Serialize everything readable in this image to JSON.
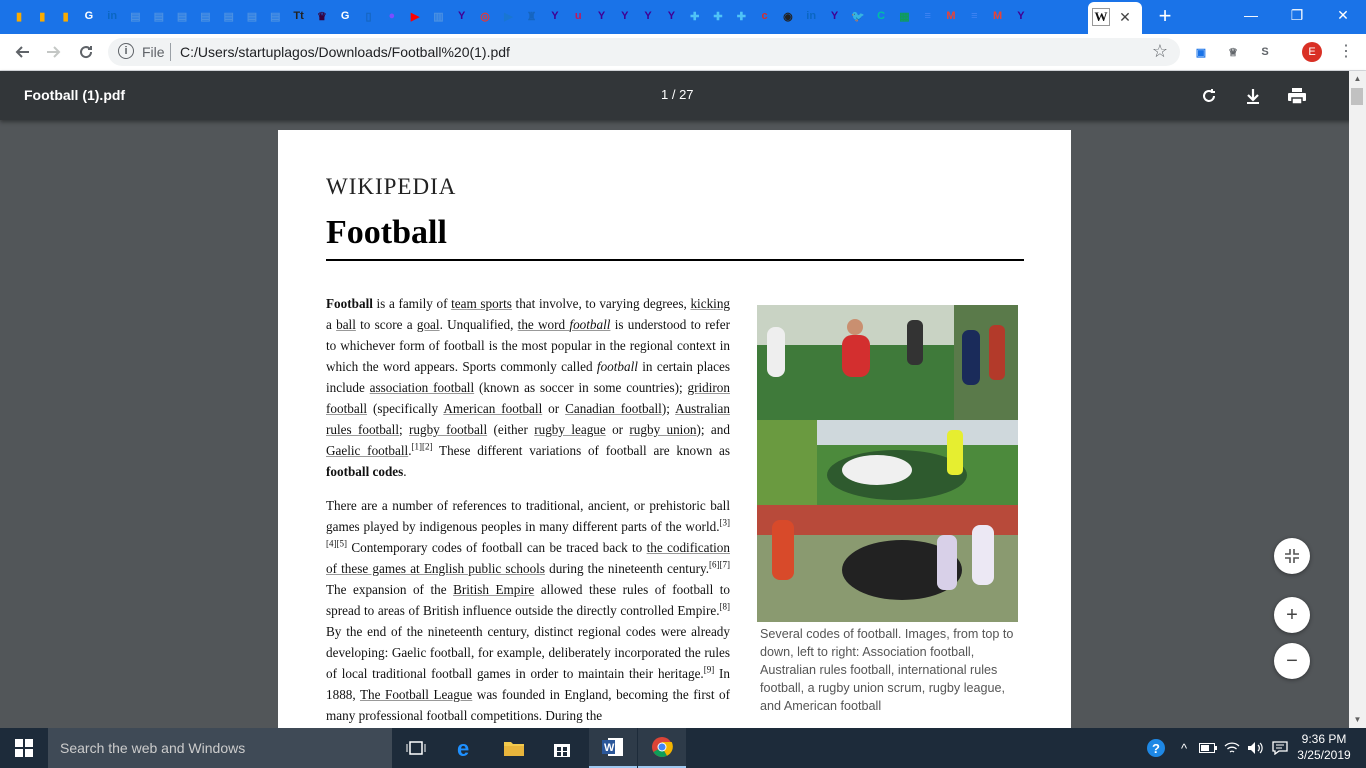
{
  "browser": {
    "tabs": [
      {
        "icon": "analytics-icon",
        "glyph": "▮",
        "color": "#f9ab00"
      },
      {
        "icon": "analytics-icon",
        "glyph": "▮",
        "color": "#f9ab00"
      },
      {
        "icon": "analytics-icon",
        "glyph": "▮",
        "color": "#f9ab00"
      },
      {
        "icon": "google-icon",
        "glyph": "G",
        "color": "#ffffff"
      },
      {
        "icon": "linkedin-icon",
        "glyph": "in",
        "color": "#0a66c2"
      },
      {
        "icon": "site-icon",
        "glyph": "▤",
        "color": "#4a90e2"
      },
      {
        "icon": "site-icon",
        "glyph": "▤",
        "color": "#4a90e2"
      },
      {
        "icon": "site-icon",
        "glyph": "▤",
        "color": "#4a90e2"
      },
      {
        "icon": "site-icon",
        "glyph": "▤",
        "color": "#4a90e2"
      },
      {
        "icon": "site-icon",
        "glyph": "▤",
        "color": "#4a90e2"
      },
      {
        "icon": "site-icon",
        "glyph": "▤",
        "color": "#4a90e2"
      },
      {
        "icon": "site-icon",
        "glyph": "▤",
        "color": "#4a90e2"
      },
      {
        "icon": "tt-icon",
        "glyph": "Tt",
        "color": "#222222"
      },
      {
        "icon": "premier-league-icon",
        "glyph": "♛",
        "color": "#37003c"
      },
      {
        "icon": "google-icon",
        "glyph": "G",
        "color": "#ffffff"
      },
      {
        "icon": "doc-icon",
        "glyph": "▯",
        "color": "#1565c0"
      },
      {
        "icon": "circle-icon",
        "glyph": "●",
        "color": "#7c4dff"
      },
      {
        "icon": "youtube-icon",
        "glyph": "▶",
        "color": "#ff0000"
      },
      {
        "icon": "chart-icon",
        "glyph": "▥",
        "color": "#4a90e2"
      },
      {
        "icon": "yahoo-icon",
        "glyph": "Y",
        "color": "#410093"
      },
      {
        "icon": "site-icon",
        "glyph": "◎",
        "color": "#e53935"
      },
      {
        "icon": "play-icon",
        "glyph": "▶",
        "color": "#1976d2"
      },
      {
        "icon": "crest-icon",
        "glyph": "♜",
        "color": "#1565c0"
      },
      {
        "icon": "yahoo-icon",
        "glyph": "Y",
        "color": "#410093"
      },
      {
        "icon": "site-icon",
        "glyph": "u",
        "color": "#c2185b"
      },
      {
        "icon": "yahoo-icon",
        "glyph": "Y",
        "color": "#410093"
      },
      {
        "icon": "yahoo-icon",
        "glyph": "Y",
        "color": "#410093"
      },
      {
        "icon": "yahoo-icon",
        "glyph": "Y",
        "color": "#410093"
      },
      {
        "icon": "yahoo-icon",
        "glyph": "Y",
        "color": "#410093"
      },
      {
        "icon": "plus-app-icon",
        "glyph": "✚",
        "color": "#4fc3f7"
      },
      {
        "icon": "plus-app-icon",
        "glyph": "✚",
        "color": "#4fc3f7"
      },
      {
        "icon": "plus-app-icon",
        "glyph": "✚",
        "color": "#4fc3f7"
      },
      {
        "icon": "site-icon",
        "glyph": "c",
        "color": "#d32f2f"
      },
      {
        "icon": "chat-icon",
        "glyph": "◉",
        "color": "#212121"
      },
      {
        "icon": "linkedin-icon",
        "glyph": "in",
        "color": "#0a66c2"
      },
      {
        "icon": "yahoo-icon",
        "glyph": "Y",
        "color": "#410093"
      },
      {
        "icon": "twitter-icon",
        "glyph": "🐦",
        "color": "#1da1f2"
      },
      {
        "icon": "site-icon",
        "glyph": "C",
        "color": "#00bfa5"
      },
      {
        "icon": "sheets-icon",
        "glyph": "▦",
        "color": "#0f9d58"
      },
      {
        "icon": "docs-icon",
        "glyph": "≡",
        "color": "#4285f4"
      },
      {
        "icon": "gmail-icon",
        "glyph": "M",
        "color": "#ea4335"
      },
      {
        "icon": "docs-icon",
        "glyph": "≡",
        "color": "#4285f4"
      },
      {
        "icon": "gmail-icon",
        "glyph": "M",
        "color": "#ea4335"
      },
      {
        "icon": "yahoo-icon",
        "glyph": "Y",
        "color": "#410093"
      }
    ],
    "active_tab": {
      "icon": "wikipedia-icon",
      "glyph": "W",
      "close": "✕"
    },
    "new_tab": "+",
    "window_controls": {
      "minimize": "—",
      "restore": "❐",
      "close": "✕"
    },
    "address": {
      "security_label": "File",
      "url": "C:/Users/startuplagos/Downloads/Football%20(1).pdf"
    },
    "extensions": [
      {
        "icon": "bookmark-app-icon",
        "glyph": "▣",
        "color": "#1a73e8"
      },
      {
        "icon": "trophy-icon",
        "glyph": "♕",
        "color": "#5f6368"
      },
      {
        "icon": "s-extension-icon",
        "glyph": "S",
        "color": "#5f6368"
      }
    ],
    "profile_initial": "E"
  },
  "pdf": {
    "title": "Football (1).pdf",
    "page_indicator": "1 / 27"
  },
  "document": {
    "wordmark": "WIKIPEDIA",
    "title": "Football",
    "caption": "Several codes of football. Images, from top to down, left to right: Association football, Australian rules football, international rules football, a rugby union scrum, rugby league, and American football"
  },
  "taskbar": {
    "search_placeholder": "Search the web and Windows",
    "time": "9:36 PM",
    "date": "3/25/2019"
  },
  "colors": {
    "tab_strip": "#1a73e8",
    "pdf_toolbar": "#323639",
    "viewer_background": "#525659",
    "taskbar": "#1d2b3a"
  }
}
